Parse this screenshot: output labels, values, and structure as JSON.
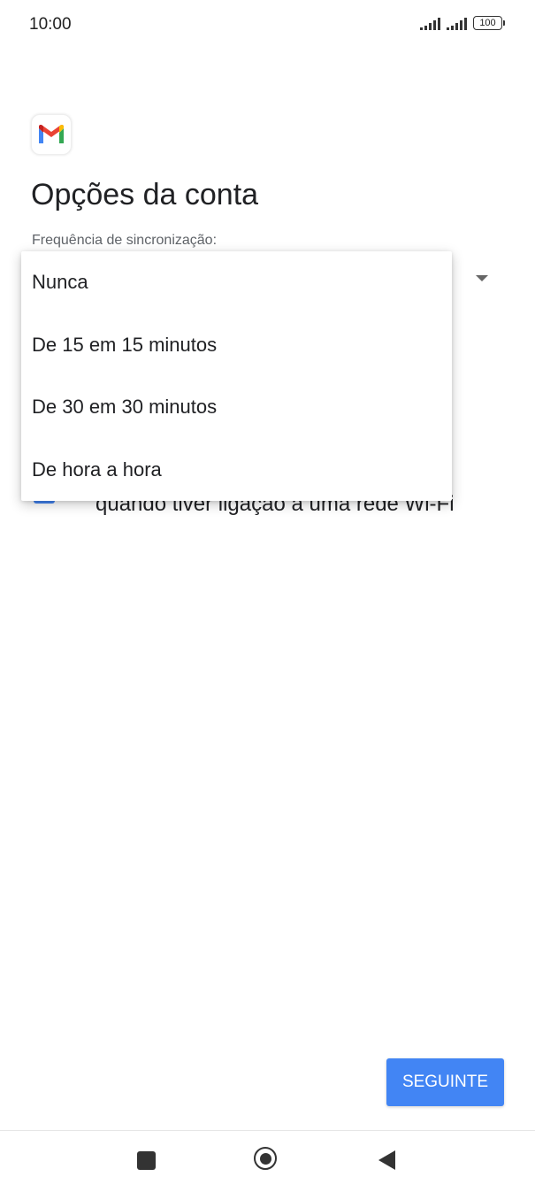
{
  "status_bar": {
    "time": "10:00",
    "battery_level": "100",
    "icons": [
      "signal-icon",
      "signal-icon",
      "battery-icon"
    ]
  },
  "app": {
    "logo_icon": "gmail-logo-icon",
    "brand_colors": {
      "red": "#EA4335",
      "blue": "#4285F4",
      "green": "#34A853",
      "yellow": "#FBBC04"
    }
  },
  "page": {
    "title": "Opções da conta",
    "sync_frequency_label": "Frequência de sincronização:",
    "wifi_checkbox_text": "quando tiver ligação a uma rede Wi-Fi",
    "wifi_checkbox_checked": true
  },
  "dropdown": {
    "options": [
      {
        "label": "Nunca"
      },
      {
        "label": "De 15 em 15 minutos"
      },
      {
        "label": "De 30 em 30 minutos"
      },
      {
        "label": "De hora a hora"
      }
    ]
  },
  "footer": {
    "next_label": "SEGUINTE",
    "accent_color": "#4285F4"
  },
  "nav_bar": {
    "icons": [
      "recents-square-icon",
      "home-circle-icon",
      "back-triangle-icon"
    ]
  }
}
